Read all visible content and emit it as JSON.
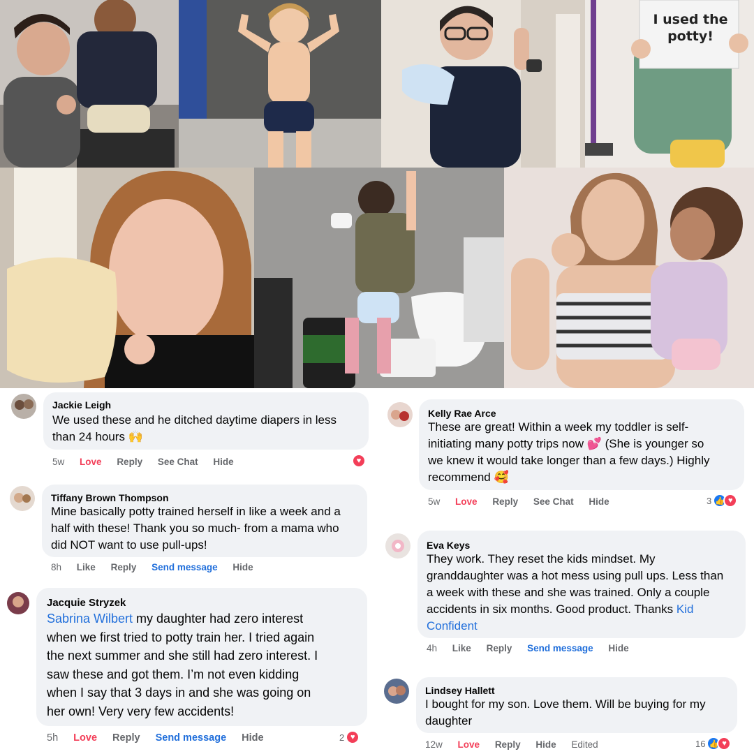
{
  "photos": {
    "sign_text": "I used the potty!"
  },
  "comments": [
    {
      "author": "Jackie Leigh",
      "lines": [
        "We used these and he ditched daytime diapers in less",
        "than 24 hours 🙌"
      ],
      "time": "5w",
      "love": "Love",
      "reply": "Reply",
      "see_chat": "See Chat",
      "hide": "Hide",
      "reaction_count": ""
    },
    {
      "author": "Tiffany Brown Thompson",
      "lines": [
        "Mine basically potty trained herself in like a week and a",
        "half with these! Thank you so much- from a mama who",
        "did NOT want to use pull-ups!"
      ],
      "time": "8h",
      "like": "Like",
      "reply": "Reply",
      "send": "Send message",
      "hide": "Hide"
    },
    {
      "author": "Jacquie Stryzek",
      "mention": "Sabrina Wilbert",
      "lines": [
        " my daughter had zero interest",
        "when we first tried to potty train her. I tried again",
        "the next summer and she still had zero interest. I",
        "saw these and got them. I’m not even kidding",
        "when I say that 3 days in and she was going on",
        "her own! Very very few accidents!"
      ],
      "time": "5h",
      "love": "Love",
      "reply": "Reply",
      "send": "Send message",
      "hide": "Hide",
      "reaction_count": "2"
    },
    {
      "author": "Kelly Rae Arce",
      "lines": [
        "These are great! Within a week my toddler is self-",
        "initiating many potty trips now 💕 (She is younger so",
        "we knew it would take longer than a few days.) Highly",
        "recommend 🥰"
      ],
      "time": "5w",
      "love": "Love",
      "reply": "Reply",
      "see_chat": "See Chat",
      "hide": "Hide",
      "reaction_count": "3"
    },
    {
      "author": "Eva Keys",
      "lines": [
        "They work. They reset the kids mindset. My",
        "granddaughter was a hot mess using pull ups. Less than",
        "a week with these and she was trained. Only a couple",
        "accidents in six months. Good product. Thanks "
      ],
      "mention_end": "Kid",
      "mention_end2": "Confident",
      "time": "4h",
      "like": "Like",
      "reply": "Reply",
      "send": "Send message",
      "hide": "Hide"
    },
    {
      "author": "Lindsey Hallett",
      "lines": [
        "I bought for my son. Love them. Will be buying for my",
        "daughter"
      ],
      "time": "12w",
      "love": "Love",
      "reply": "Reply",
      "hide": "Hide",
      "edited": "Edited",
      "reaction_count": "16"
    }
  ],
  "colors": {
    "bubble": "#f0f2f5",
    "love": "#f33e58",
    "link": "#216fdb",
    "like": "#1877f2",
    "meta": "#65676b"
  }
}
